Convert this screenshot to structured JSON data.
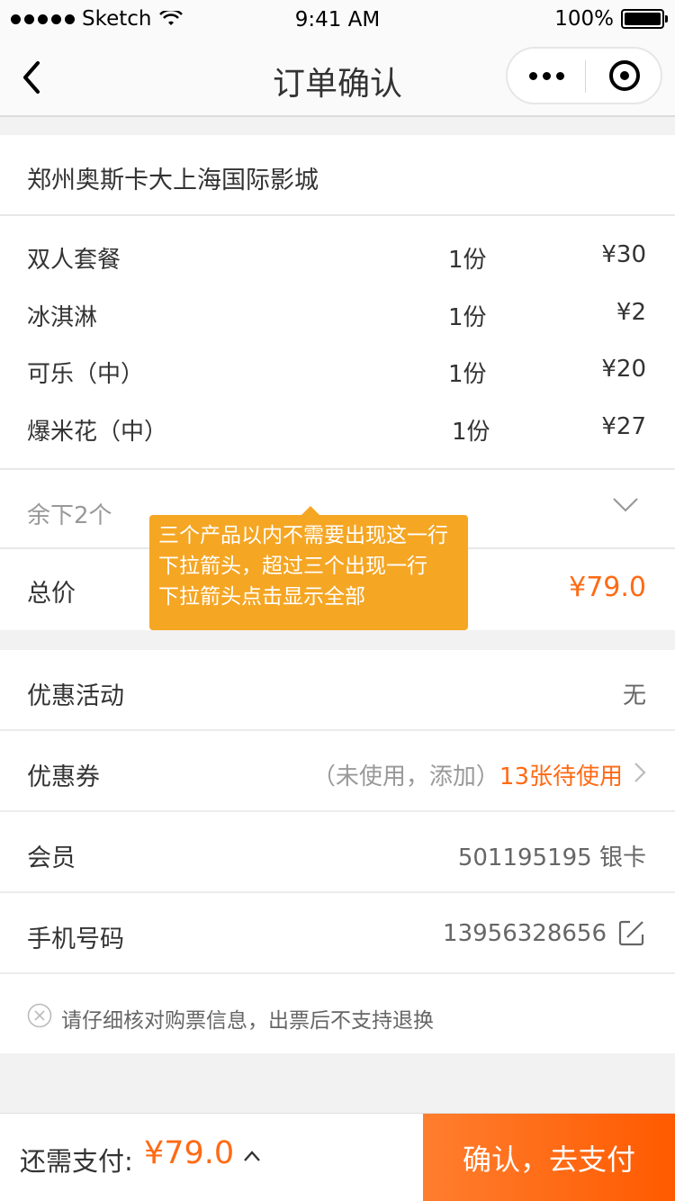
{
  "status_bar": {
    "carrier": "Sketch",
    "time": "9:41 AM",
    "battery": "100%"
  },
  "nav": {
    "title": "订单确认"
  },
  "cinema": {
    "name": "郑州奥斯卡大上海国际影城"
  },
  "items": [
    {
      "name": "双人套餐",
      "qty": "1份",
      "price": "¥30"
    },
    {
      "name": "冰淇淋",
      "qty": "1份",
      "price": "¥2"
    },
    {
      "name": "可乐（中）",
      "qty": "1份",
      "price": "¥20"
    },
    {
      "name": "爆米花（中）",
      "qty": "1份",
      "price": "¥27"
    }
  ],
  "remaining": {
    "label": "余下2个"
  },
  "total": {
    "label": "总价",
    "value": "¥79.0"
  },
  "tooltip": {
    "lines": [
      "三个产品以内不需要出现这一行",
      "下拉箭头，超过三个出现一行",
      "下拉箭头点击显示全部"
    ]
  },
  "promotion": {
    "label": "优惠活动",
    "value": "无"
  },
  "coupon": {
    "label": "优惠券",
    "status": "（未使用，添加）",
    "count": "13张待使用"
  },
  "member": {
    "label": "会员",
    "value": "501195195  银卡"
  },
  "phone": {
    "label": "手机号码",
    "value": "13956328656"
  },
  "notice": {
    "text": "请仔细核对购票信息，出票后不支持退换"
  },
  "footer": {
    "pay_label": "还需支付:",
    "pay_amount": "¥79.0",
    "confirm": "确认，去支付"
  },
  "colors": {
    "accent": "#ff6a14",
    "tooltip": "#f5a623"
  }
}
